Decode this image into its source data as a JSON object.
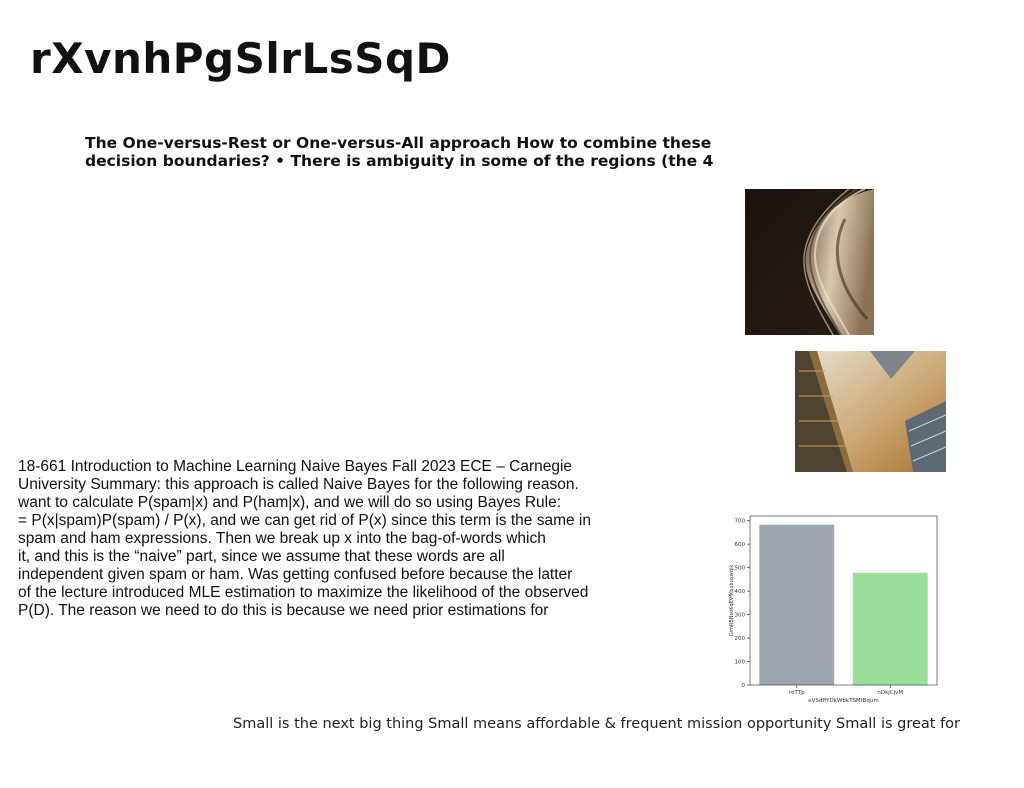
{
  "page": {
    "title": "rXvnhPgSlrLsSqD",
    "paragraph_lines": [
      "The One-versus-Rest or One-versus-All approach How to combine these",
      "decision boundaries? • There is ambiguity in some of the regions (the 4"
    ],
    "notes_lines": [
      "18-661 Introduction to Machine Learning Naive Bayes Fall 2023 ECE – Carnegie",
      "University Summary: this approach is called Naive Bayes for the following reason.",
      "want to calculate P(spam|x) and P(ham|x), and we will do so using Bayes Rule:",
      "= P(x|spam)P(spam) / P(x), and we can get rid of P(x) since this term is the same in",
      "spam and ham expressions. Then we break up x into the bag-of-words which",
      "it, and this is the “naive” part, since we assume that these words are all",
      "independent given spam or ham. Was getting confused before because the latter",
      "of the lecture introduced MLE estimation to maximize the likelihood of the observed",
      "P(D). The reason we need to do this is because we need prior estimations for"
    ],
    "caption": "Small is the next big thing Small means affordable & frequent mission opportunity Small is great for"
  },
  "chart_data": {
    "type": "bar",
    "categories": [
      "roTTp",
      "nDkjCjvM"
    ],
    "values": [
      683,
      478
    ],
    "colors": [
      "#9da6b0",
      "#99df99"
    ],
    "xlabel": "eVSdffYDkWbkTSMfBqum",
    "ylabel": "GimRBNsoKqEVfKbxbuxwqik",
    "ylim": [
      0,
      720
    ],
    "yticks": [
      0,
      100,
      200,
      300,
      400,
      500,
      600,
      700
    ],
    "grid": false
  }
}
